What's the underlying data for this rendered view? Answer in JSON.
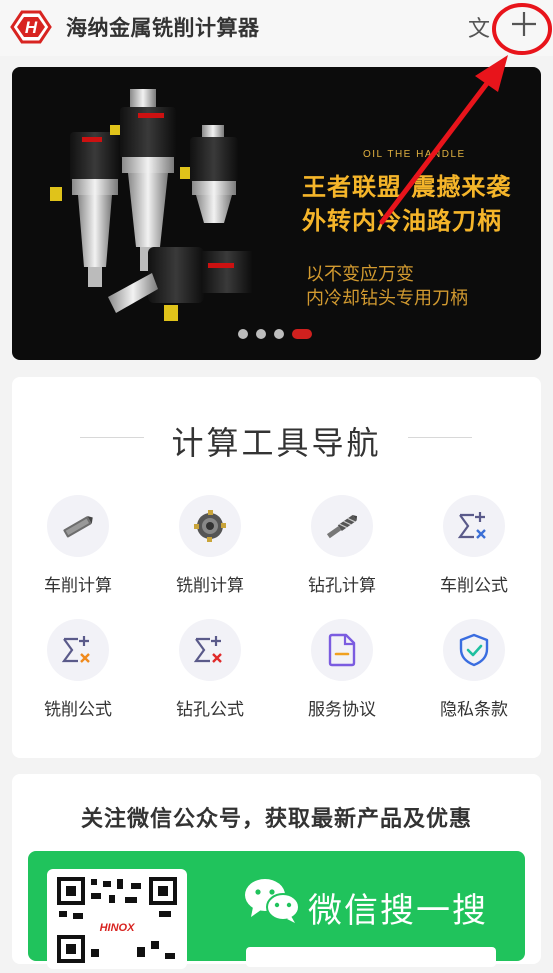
{
  "header": {
    "title": "海纳金属铣削计算器",
    "lang_label": "文",
    "plus_icon": "plus-icon",
    "logo_letter": "H",
    "brand_color": "#d82421"
  },
  "banner": {
    "tagline_en": "OIL THE HANDLE",
    "headline_1": "王者联盟 震撼来袭",
    "headline_2": "外转内冷油路刀柄",
    "sub_1": "以不变应万变",
    "sub_2": "内冷却钻头专用刀柄",
    "carousel_slide_count": 4,
    "carousel_active_index": 3
  },
  "nav": {
    "title": "计算工具导航",
    "tools": [
      {
        "label": "车削计算",
        "icon": "turning-tool-icon"
      },
      {
        "label": "铣削计算",
        "icon": "milling-cutter-icon"
      },
      {
        "label": "钻孔计算",
        "icon": "drill-bit-icon"
      },
      {
        "label": "车削公式",
        "icon": "sigma-plus-icon"
      },
      {
        "label": "铣削公式",
        "icon": "sigma-plus-orange-icon"
      },
      {
        "label": "钻孔公式",
        "icon": "sigma-plus-red-icon"
      },
      {
        "label": "服务协议",
        "icon": "document-icon"
      },
      {
        "label": "隐私条款",
        "icon": "shield-check-icon"
      }
    ]
  },
  "follow": {
    "title": "关注微信公众号，获取最新产品及优惠",
    "wechat_label": "微信搜一搜",
    "qr_brand": "HINOX",
    "wechat_color": "#20c35c"
  },
  "annotation": {
    "color": "#e8141b"
  }
}
